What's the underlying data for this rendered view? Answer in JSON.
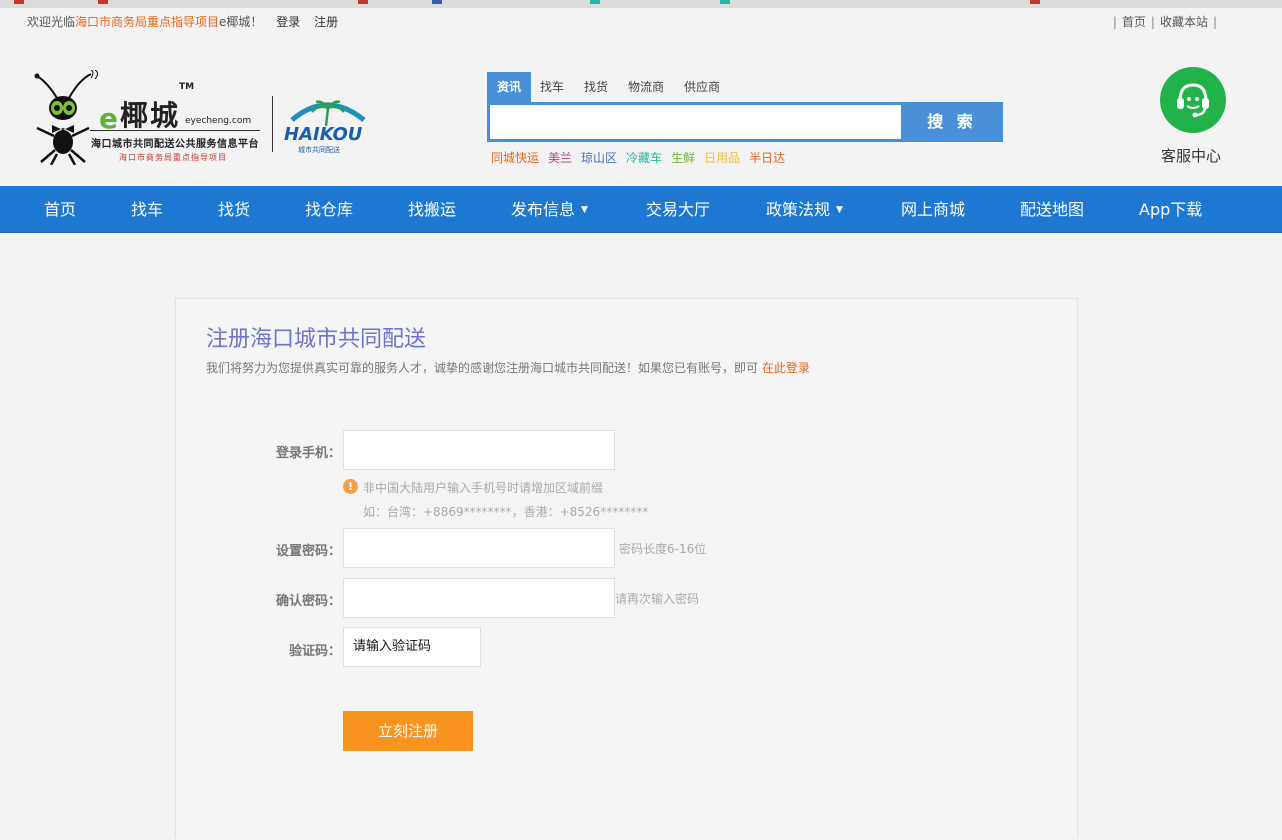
{
  "topbar": {
    "welcome_prefix": "欢迎光临",
    "welcome_highlight": "海口市商务局重点指导项目",
    "welcome_suffix": "e椰城！",
    "login": "登录",
    "register": "注册",
    "home": "首页",
    "bookmark": "收藏本站"
  },
  "logo": {
    "e": "e",
    "name": "椰城",
    "tm": "TM",
    "url": "eyecheng.com",
    "subtitle": "海口城市共同配送公共服务信息平台",
    "subtitle2": "海口市商务局重点指导项目",
    "partner": "HAIKOU",
    "partner_sub": "城市共同配送"
  },
  "search": {
    "tabs": [
      "资讯",
      "找车",
      "找货",
      "物流商",
      "供应商"
    ],
    "active_tab": "资讯",
    "placeholder": "",
    "button": "搜 索",
    "hot": [
      {
        "label": "同城快运",
        "color": "#e8651a"
      },
      {
        "label": "美兰",
        "color": "#c0398a"
      },
      {
        "label": "琼山区",
        "color": "#4a6fb5"
      },
      {
        "label": "冷藏车",
        "color": "#2bb3a3"
      },
      {
        "label": "生鲜",
        "color": "#6cb82e"
      },
      {
        "label": "日用品",
        "color": "#f2c230"
      },
      {
        "label": "半日达",
        "color": "#e8651a"
      }
    ]
  },
  "service": {
    "label": "客服中心",
    "color": "#21b24a"
  },
  "nav": {
    "items": [
      "首页",
      "找车",
      "找货",
      "找仓库",
      "找搬运",
      "发布信息",
      "交易大厅",
      "政策法规",
      "网上商城",
      "配送地图",
      "App下载"
    ],
    "dropdown_caret": "▼",
    "color": "#1e78d2"
  },
  "register": {
    "title": "注册海口城市共同配送",
    "desc": "我们将努力为您提供真实可靠的服务人才，诚挚的感谢您注册海口城市共同配送！如果您已有账号，即可",
    "login_link": "在此登录",
    "phone_label": "登录手机：",
    "phone_warn_icon": "!",
    "phone_hint1": "非中国大陆用户输入手机号时请增加区域前缀",
    "phone_hint2": "如：台湾：+8869********，香港：+8526********",
    "pwd_label": "设置密码：",
    "pwd_hint": "密码长度6-16位",
    "confirm_label": "确认密码：",
    "confirm_hint": "请再次输入密码",
    "captcha_label": "验证码：",
    "captcha_value": "请输入验证码",
    "submit": "立刻注册",
    "submit_color": "#f7931e"
  }
}
